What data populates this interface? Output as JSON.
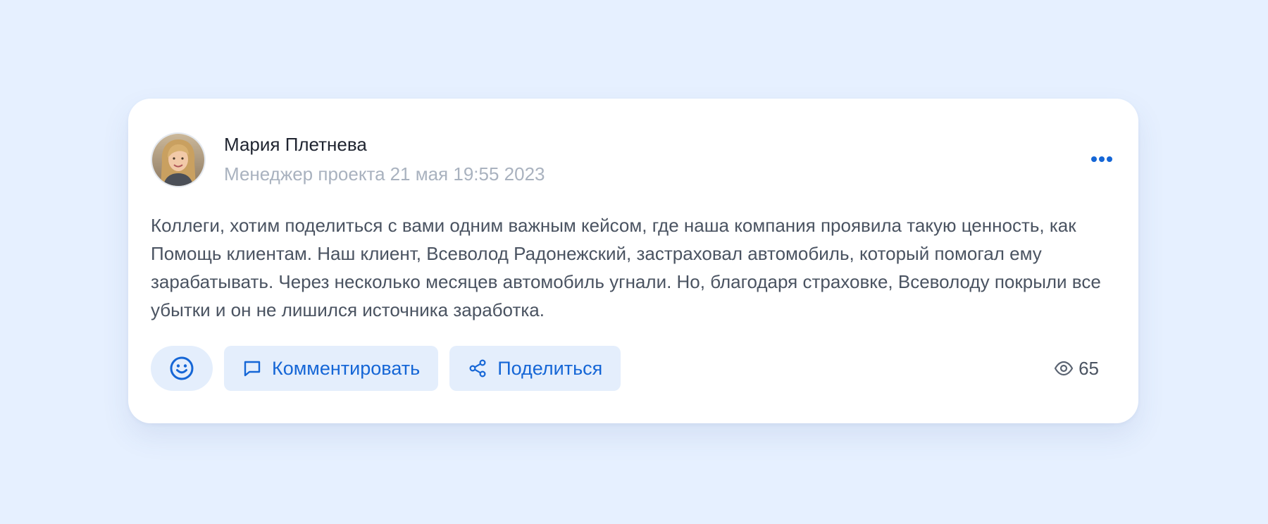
{
  "post": {
    "author": {
      "name": "Мария Плетнева",
      "role": "Менеджер проекта",
      "avatar_icon": "user-photo"
    },
    "date": "21 мая 19:55 2023",
    "text": "Коллеги, хотим поделиться с вами одним важным кейсом, где наша компания проявила такую ценность, как Помощь клиентам. Наш клиент, Всеволод Радонежский, застраховал автомобиль, который помогал ему зарабатывать. Через несколько месяцев автомобиль угнали. Но, благодаря страховке, Всеволоду покрыли все убытки и он не лишился источника заработка.",
    "menu_icon": "more-horizontal-icon",
    "actions": {
      "reaction_icon": "smile-icon",
      "comment": {
        "label": "Комментировать",
        "icon": "comment-icon"
      },
      "share": {
        "label": "Поделиться",
        "icon": "share-icon"
      }
    },
    "views": {
      "icon": "eye-icon",
      "count": "65"
    }
  },
  "colors": {
    "background": "#e6f0ff",
    "card": "#ffffff",
    "accent": "#1566d6",
    "button_bg": "#e4eefc",
    "text_primary": "#1f2430",
    "text_body": "#4a5361",
    "text_muted": "#a9b2bf"
  }
}
